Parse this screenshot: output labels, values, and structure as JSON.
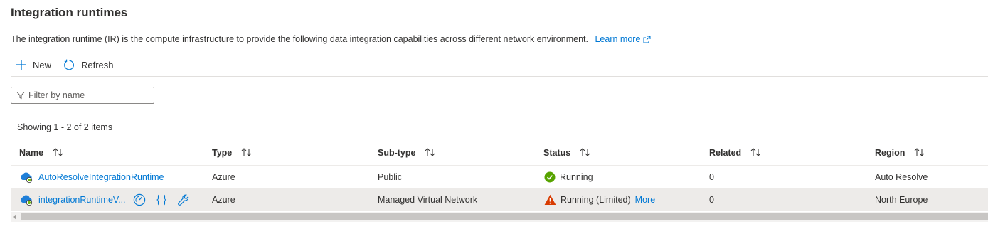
{
  "page": {
    "title": "Integration runtimes",
    "description": "The integration runtime (IR) is the compute infrastructure to provide the following data integration capabilities across different network environment.",
    "learn_more": "Learn more"
  },
  "toolbar": {
    "new_label": "New",
    "refresh_label": "Refresh"
  },
  "filter": {
    "placeholder": "Filter by name",
    "value": ""
  },
  "showing": "Showing 1 - 2 of 2 items",
  "table": {
    "columns": [
      "Name",
      "Type",
      "Sub-type",
      "Status",
      "Related",
      "Region"
    ],
    "rows": [
      {
        "name": "AutoResolveIntegrationRuntime",
        "type": "Azure",
        "subtype": "Public",
        "status": "Running",
        "status_kind": "success",
        "more": "",
        "related": "0",
        "region": "Auto Resolve"
      },
      {
        "name": "integrationRuntimeV...",
        "type": "Azure",
        "subtype": "Managed Virtual Network",
        "status": "Running (Limited)",
        "status_kind": "warning",
        "more": "More",
        "related": "0",
        "region": "North Europe"
      }
    ]
  },
  "icons": {
    "new": "plus-icon",
    "refresh": "refresh-icon",
    "filter": "filter-icon",
    "external": "external-link-icon",
    "cloud": "azure-cloud-icon",
    "monitor": "gauge-icon",
    "code": "code-braces-icon",
    "edit": "wrench-icon",
    "success": "success-check-icon",
    "warning": "warning-triangle-icon"
  },
  "colors": {
    "link": "#0078d4",
    "success": "#107c10",
    "warning": "#d83b01",
    "selected_row": "#edebe9"
  }
}
